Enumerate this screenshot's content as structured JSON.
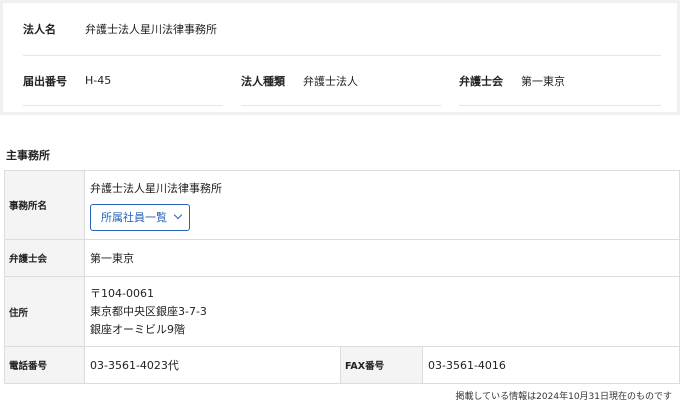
{
  "summary": {
    "corp_name_label": "法人名",
    "corp_name_value": "弁護士法人星川法律事務所",
    "filing_no_label": "届出番号",
    "filing_no_value": "H-45",
    "corp_type_label": "法人種類",
    "corp_type_value": "弁護士法人",
    "bar_label": "弁護士会",
    "bar_value": "第一東京"
  },
  "main_office": {
    "section_title": "主事務所",
    "office_name_label": "事務所名",
    "office_name_value": "弁護士法人星川法律事務所",
    "members_button": "所属社員一覧",
    "bar_label": "弁護士会",
    "bar_value": "第一東京",
    "address_label": "住所",
    "address_lines": [
      "〒104-0061",
      "東京都中央区銀座3-7-3",
      "銀座オーミビル9階"
    ],
    "phone_label": "電話番号",
    "phone_value": "03-3561-4023代",
    "fax_label": "FAX番号",
    "fax_value": "03-3561-4016"
  },
  "footer_note": "掲載している情報は2024年10月31日現在のものです"
}
